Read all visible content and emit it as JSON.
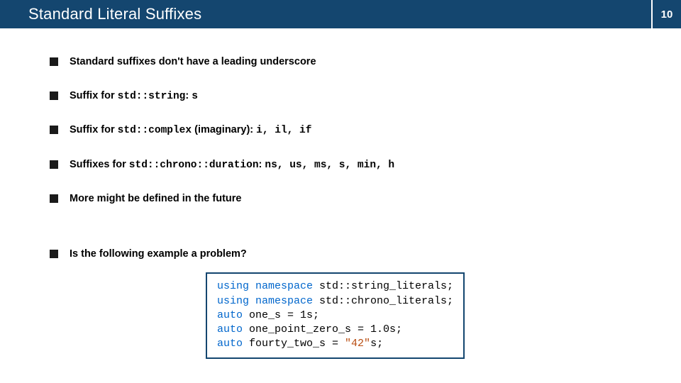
{
  "header": {
    "title": "Standard Literal Suffixes",
    "page_number": "10"
  },
  "bullets": {
    "b0": "Standard suffixes don't have a leading underscore",
    "b1_prefix": "Suffix for ",
    "b1_code": "std::string",
    "b1_after": ": ",
    "b1_suffix": "s",
    "b2_prefix": "Suffix for ",
    "b2_code": "std::complex",
    "b2_after": " (imaginary): ",
    "b2_suffix": "i, il, if",
    "b3_prefix": "Suffixes for ",
    "b3_code": "std::chrono::duration",
    "b3_after": ": ",
    "b3_suffix": "ns, us, ms, s, min, h",
    "b4": "More might be defined in the future",
    "b5": "Is the following example a problem?"
  },
  "code": {
    "kw_using1": "using namespace",
    "ns1": " std::string_literals;",
    "kw_using2": "using namespace",
    "ns2": " std::chrono_literals;",
    "kw_auto1": "auto",
    "line1": " one_s = 1s;",
    "kw_auto2": "auto",
    "line2": " one_point_zero_s = 1.0s;",
    "kw_auto3": "auto",
    "line3_a": " fourty_two_s = ",
    "line3_str": "\"42\"",
    "line3_b": "s;"
  }
}
